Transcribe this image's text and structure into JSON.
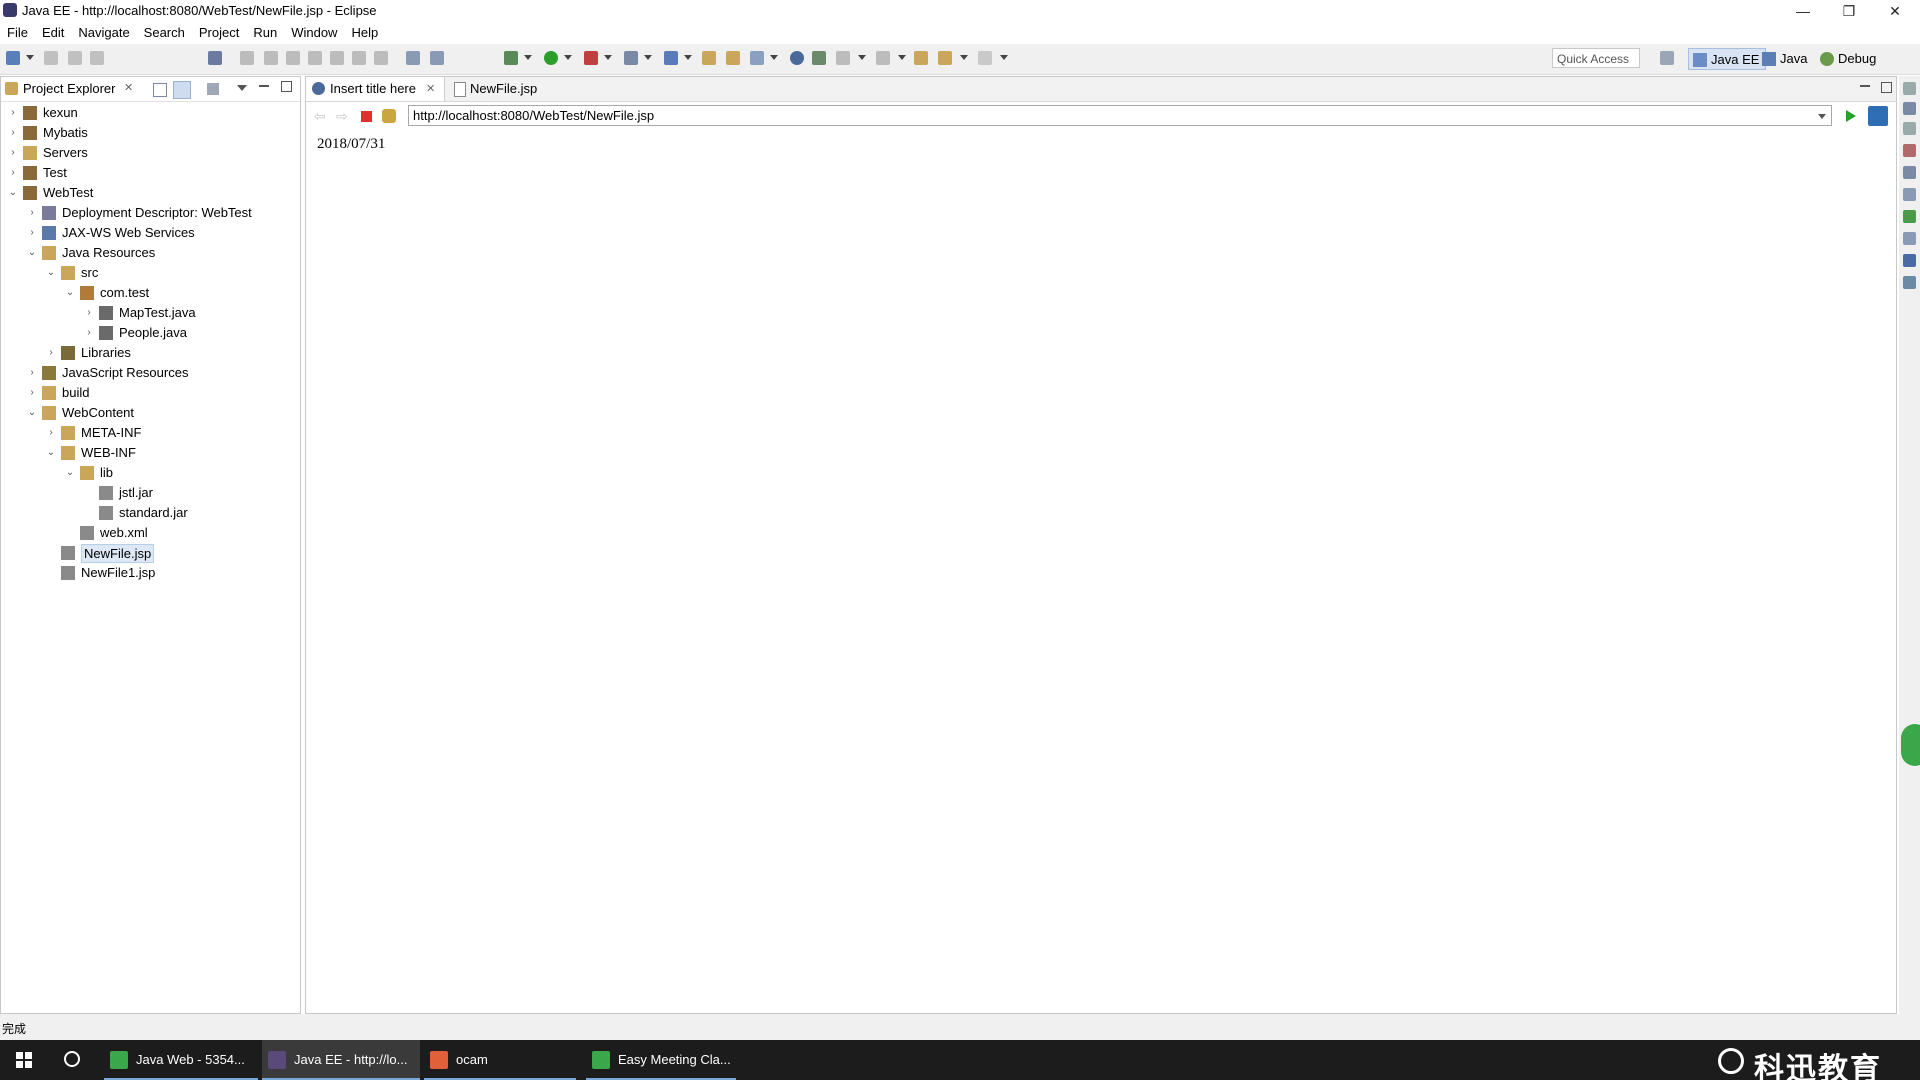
{
  "window": {
    "title": "Java EE - http://localhost:8080/WebTest/NewFile.jsp - Eclipse",
    "minimize": "—",
    "restore": "❐",
    "close": "✕"
  },
  "menu": [
    "File",
    "Edit",
    "Navigate",
    "Search",
    "Project",
    "Run",
    "Window",
    "Help"
  ],
  "toolbar": {
    "quick_access": "Quick Access",
    "perspectives": [
      {
        "label": "Java EE",
        "active": true,
        "color": "#6d8cc7"
      },
      {
        "label": "Java",
        "active": false,
        "color": "#5b7fb5"
      },
      {
        "label": "Debug",
        "active": false,
        "color": "#6a9a4a"
      }
    ]
  },
  "project_explorer": {
    "title": "Project Explorer",
    "close_glyph": "✕",
    "items": [
      {
        "label": "kexun",
        "level": 0,
        "twisty": "›",
        "icon": "project-icon",
        "color": "#8a6a3a"
      },
      {
        "label": "Mybatis",
        "level": 0,
        "twisty": "›",
        "icon": "project-icon",
        "color": "#8a6a3a"
      },
      {
        "label": "Servers",
        "level": 0,
        "twisty": "›",
        "icon": "folder-icon",
        "color": "#c9a65a"
      },
      {
        "label": "Test",
        "level": 0,
        "twisty": "›",
        "icon": "project-icon",
        "color": "#8a6a3a"
      },
      {
        "label": "WebTest",
        "level": 0,
        "twisty": "⌄",
        "icon": "project-icon",
        "color": "#8a6a3a"
      },
      {
        "label": "Deployment Descriptor: WebTest",
        "level": 1,
        "twisty": "›",
        "icon": "descriptor-icon",
        "color": "#7a7a9a"
      },
      {
        "label": "JAX-WS Web Services",
        "level": 1,
        "twisty": "›",
        "icon": "webservice-icon",
        "color": "#5a7aaa"
      },
      {
        "label": "Java Resources",
        "level": 1,
        "twisty": "⌄",
        "icon": "java-resources-icon",
        "color": "#c9a65a"
      },
      {
        "label": "src",
        "level": 2,
        "twisty": "⌄",
        "icon": "source-folder-icon",
        "color": "#c9a65a"
      },
      {
        "label": "com.test",
        "level": 3,
        "twisty": "⌄",
        "icon": "package-icon",
        "color": "#b07a3a"
      },
      {
        "label": "MapTest.java",
        "level": 4,
        "twisty": "›",
        "icon": "java-file-icon",
        "color": "#6a6a6a"
      },
      {
        "label": "People.java",
        "level": 4,
        "twisty": "›",
        "icon": "java-file-icon",
        "color": "#6a6a6a"
      },
      {
        "label": "Libraries",
        "level": 2,
        "twisty": "›",
        "icon": "library-icon",
        "color": "#7a6a3a"
      },
      {
        "label": "JavaScript Resources",
        "level": 1,
        "twisty": "›",
        "icon": "js-resources-icon",
        "color": "#8a7a3a"
      },
      {
        "label": "build",
        "level": 1,
        "twisty": "›",
        "icon": "folder-icon",
        "color": "#c9a65a"
      },
      {
        "label": "WebContent",
        "level": 1,
        "twisty": "⌄",
        "icon": "folder-icon",
        "color": "#c9a65a"
      },
      {
        "label": "META-INF",
        "level": 2,
        "twisty": "›",
        "icon": "folder-icon",
        "color": "#c9a65a"
      },
      {
        "label": "WEB-INF",
        "level": 2,
        "twisty": "⌄",
        "icon": "folder-icon",
        "color": "#c9a65a"
      },
      {
        "label": "lib",
        "level": 3,
        "twisty": "⌄",
        "icon": "folder-icon",
        "color": "#c9a65a"
      },
      {
        "label": "jstl.jar",
        "level": 4,
        "twisty": "",
        "icon": "jar-icon",
        "color": "#8a8a8a"
      },
      {
        "label": "standard.jar",
        "level": 4,
        "twisty": "",
        "icon": "jar-icon",
        "color": "#8a8a8a"
      },
      {
        "label": "web.xml",
        "level": 3,
        "twisty": "",
        "icon": "xml-file-icon",
        "color": "#8a8a8a"
      },
      {
        "label": "NewFile.jsp",
        "level": 2,
        "twisty": "",
        "icon": "jsp-file-icon",
        "color": "#8a8a8a",
        "selected": true
      },
      {
        "label": "NewFile1.jsp",
        "level": 2,
        "twisty": "",
        "icon": "jsp-file-icon",
        "color": "#8a8a8a"
      }
    ]
  },
  "editor": {
    "tabs": [
      {
        "label": "Insert title here",
        "active": true,
        "icon": "globe-icon",
        "close": "✕"
      },
      {
        "label": "NewFile.jsp",
        "active": false,
        "icon": "jsp-file-icon",
        "close": ""
      }
    ],
    "url": "http://localhost:8080/WebTest/NewFile.jsp",
    "page_text": "2018/07/31"
  },
  "status": {
    "text": "完成"
  },
  "taskbar": {
    "items": [
      {
        "label": "Java Web - 5354...",
        "color": "#3aa84a",
        "active": false
      },
      {
        "label": "Java EE - http://lo...",
        "color": "#5a4a7a",
        "active": true
      },
      {
        "label": "ocam",
        "color": "#e0603a",
        "active": false
      },
      {
        "label": "Easy Meeting Cla...",
        "color": "#3aa84a",
        "active": false
      }
    ],
    "brand": "科迅教育"
  },
  "colors": {
    "accent": "#2f6db5",
    "selection": "#dde8f6",
    "stop": "#e03030",
    "go": "#2aa02a"
  }
}
